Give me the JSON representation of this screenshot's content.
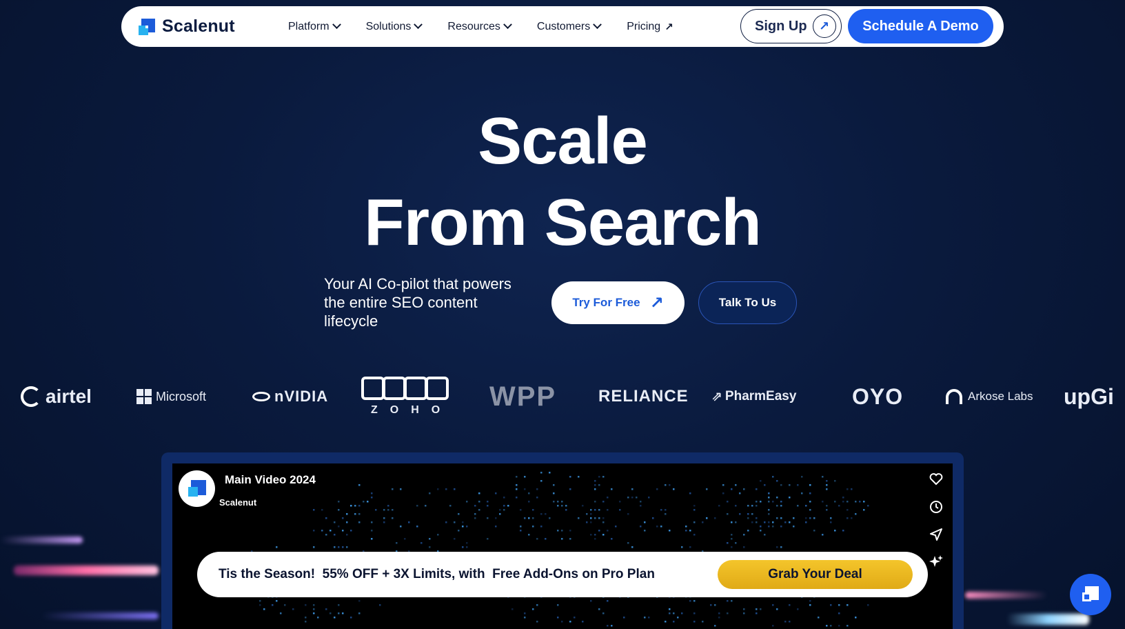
{
  "nav": {
    "brand": "Scalenut",
    "menu": [
      {
        "label": "Platform",
        "icon": "chevron-down-icon"
      },
      {
        "label": "Solutions",
        "icon": "chevron-down-icon"
      },
      {
        "label": "Resources",
        "icon": "chevron-down-icon"
      },
      {
        "label": "Customers",
        "icon": "chevron-down-icon"
      },
      {
        "label": "Pricing",
        "icon": "external-arrow-icon"
      }
    ],
    "signup_label": "Sign Up",
    "demo_label": "Schedule A Demo"
  },
  "hero": {
    "line1": "Scale",
    "line2": "From Search",
    "subtitle": "Your AI Co-pilot that powers the entire SEO content lifecycle",
    "try_label": "Try For Free",
    "talk_label": "Talk To Us"
  },
  "logos": [
    "airtel",
    "Microsoft",
    "nVIDIA",
    "ZOHO",
    "WPP",
    "RELIANCE",
    "PharmEasy",
    "OYO",
    "Arkose Labs",
    "upGi"
  ],
  "video": {
    "title": "Main Video 2024",
    "channel": "Scalenut",
    "side_icons": [
      "heart-icon",
      "clock-icon",
      "send-icon",
      "sparkle-icon"
    ]
  },
  "promo": {
    "text": "Tis the Season!  55% OFF + 3X Limits, with  Free Add-Ons on Pro Plan",
    "button_label": "Grab Your Deal"
  },
  "colors": {
    "brand_blue": "#1f5ff0",
    "background": "#0a1a3d",
    "promo_yellow": "#f4c52b"
  }
}
